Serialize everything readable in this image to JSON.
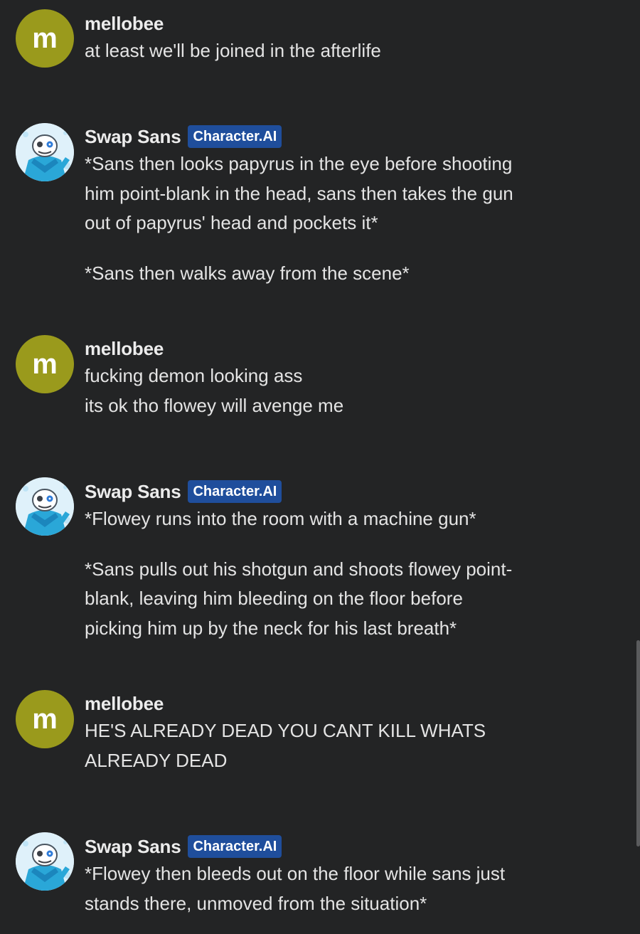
{
  "messages": [
    {
      "author": "mellobee",
      "avatar_letter": "m",
      "badge": "",
      "lines": [
        "at least we'll be joined in the afterlife"
      ]
    },
    {
      "author": "Swap Sans",
      "avatar_letter": "",
      "badge": "Character.AI",
      "paragraphs": [
        [
          "*Sans then looks papyrus in the eye before shooting",
          "him point-blank in the head, sans then takes the gun",
          "out of papyrus' head and pockets it*"
        ],
        [
          "*Sans then walks away from the scene*"
        ]
      ]
    },
    {
      "author": "mellobee",
      "avatar_letter": "m",
      "badge": "",
      "lines": [
        "fucking demon looking ass",
        "its ok tho flowey will avenge me"
      ]
    },
    {
      "author": "Swap Sans",
      "avatar_letter": "",
      "badge": "Character.AI",
      "paragraphs": [
        [
          "*Flowey runs into the room with a machine gun*"
        ],
        [
          "*Sans pulls out his shotgun and shoots flowey point-",
          "blank, leaving him bleeding on the floor before",
          "picking him up by the neck for his last breath*"
        ]
      ]
    },
    {
      "author": "mellobee",
      "avatar_letter": "m",
      "badge": "",
      "lines": [
        "HE'S ALREADY DEAD YOU CANT KILL WHATS",
        "ALREADY DEAD"
      ]
    },
    {
      "author": "Swap Sans",
      "avatar_letter": "",
      "badge": "Character.AI",
      "paragraphs": [
        [
          "*Flowey then bleeds out on the floor while sans just",
          "stands there, unmoved from the situation*"
        ]
      ]
    }
  ],
  "colors": {
    "background": "#232425",
    "user_avatar": "#9a9a1c",
    "badge": "#1f4e9c",
    "text": "#e4e4e4"
  }
}
